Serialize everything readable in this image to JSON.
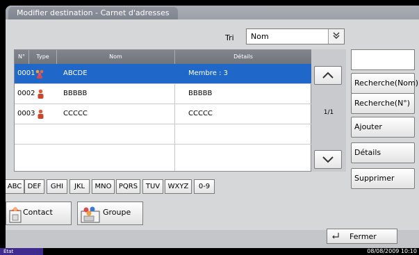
{
  "window": {
    "title": "Modifier destination - Carnet d'adresses"
  },
  "sort": {
    "label": "Tri",
    "value": "Nom"
  },
  "table": {
    "headers": [
      "N°",
      "Type",
      "Nom",
      "Détails"
    ],
    "rows": [
      {
        "no": "0001",
        "type": "group",
        "name": "ABCDE",
        "details": "Membre : 3",
        "selected": true
      },
      {
        "no": "0002",
        "type": "contact",
        "name": "BBBBB",
        "details": "BBBBB",
        "selected": false
      },
      {
        "no": "0003",
        "type": "contact",
        "name": "CCCCC",
        "details": "CCCCC",
        "selected": false
      }
    ]
  },
  "pagination": {
    "page": "1/1"
  },
  "search_box": {
    "value": ""
  },
  "right_buttons": {
    "search_name": "Recherche(Nom)",
    "search_num": "Recherche(N°)",
    "add": "Ajouter",
    "details": "Détails",
    "delete": "Supprimer"
  },
  "alpha_buttons": [
    "ABC",
    "DEF",
    "GHI",
    "JKL",
    "MNO",
    "PQRS",
    "TUV",
    "WXYZ",
    "0-9"
  ],
  "filters": {
    "contact": "Contact",
    "group": "Groupe"
  },
  "bottom": {
    "close": "Fermer"
  },
  "status": {
    "label": "État",
    "datetime": "08/08/2009  10:10"
  },
  "colors": {
    "selection": "#1f67c9",
    "header": "#7a7f88",
    "status_tab": "#3f2a90"
  },
  "icons": {
    "group": "group-icon",
    "contact": "contact-icon",
    "up": "chevron-up-icon",
    "down": "chevron-down-icon",
    "return": "return-icon"
  }
}
